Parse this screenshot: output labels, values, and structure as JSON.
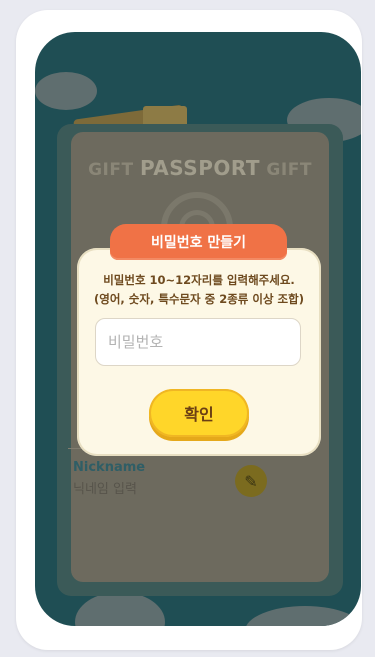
{
  "background": {
    "passport_title_left": "GIFT",
    "passport_title_main": "PASSPORT",
    "passport_title_right": "GIFT",
    "nickname_label": "Nickname",
    "nickname_placeholder": "닉네임 입력",
    "edit_icon": "pencil-icon"
  },
  "modal": {
    "title": "비밀번호 만들기",
    "message_line1": "비밀번호 10~12자리를 입력해주세요.",
    "message_line2": "(영어, 숫자, 특수문자 중 2종류 이상 조합)",
    "password_placeholder": "비밀번호",
    "password_value": "",
    "confirm_label": "확인"
  },
  "colors": {
    "title_tab": "#f07246",
    "confirm_button": "#ffd629",
    "modal_bg": "#fdf8e6",
    "screen_bg": "#1f4e54"
  }
}
